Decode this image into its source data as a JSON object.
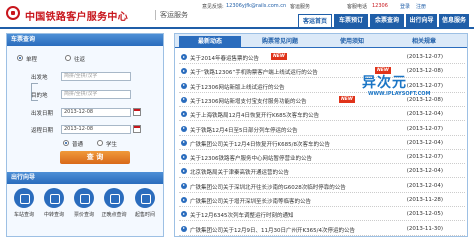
{
  "header": {
    "site_name": "中国铁路客户服务中心",
    "site_sub": "客运服务",
    "welcome": "意见反馈:",
    "email": "12306yjfk@rails.com.cn",
    "service_label": "客运服务",
    "service_hotline_label": "客服电话",
    "hotline": "12306",
    "login": "登录",
    "register": "注册"
  },
  "nav": {
    "tabs": [
      "客运首页",
      "车票预订",
      "余票查询",
      "出行向导",
      "信息服务"
    ]
  },
  "ticket_query": {
    "title": "车票查询",
    "oneway_label": "单程",
    "roundtrip_label": "往返",
    "from_label": "出发地",
    "from_placeholder": "简拼/全拼/汉字",
    "to_label": "目的地",
    "to_placeholder": "简拼/全拼/汉字",
    "depart_label": "出发日期",
    "depart_date": "2013-12-08",
    "return_label": "返程日期",
    "return_date": "2013-12-08",
    "normal_label": "普通",
    "student_label": "学生",
    "query_button": "查  询"
  },
  "travel_guide": {
    "title": "出行向导",
    "items": [
      "车站查询",
      "中转查询",
      "票价查询",
      "正晚点查询",
      "起售时间"
    ]
  },
  "news": {
    "tabs": [
      "最新动态",
      "购票常见问题",
      "使用须知",
      "相关规章"
    ],
    "items": [
      {
        "title": "关于2014年春运售票的公告",
        "new": true,
        "date": "(2013-12-07)"
      },
      {
        "title": "关于“铁路12306”手机购票客户端上线试运行的公告",
        "new": true,
        "date": "(2013-12-08)"
      },
      {
        "title": "关于12306网站新版上线试运行的公告",
        "new": false,
        "date": "(2013-12-07)"
      },
      {
        "title": "关于12306网站新增支付宝支付服务功能的公告",
        "new": true,
        "date": "(2013-12-08)"
      },
      {
        "title": "关于上海铁路局12月4日恢复开行K685次客车的公告",
        "new": false,
        "date": "(2013-12-04)"
      },
      {
        "title": "关于铁路12月4日至5日部分列车停运的公告",
        "new": false,
        "date": "(2013-12-07)"
      },
      {
        "title": "广铁集团公司关于12月4日恢复开行K685/8次客车的公告",
        "new": false,
        "date": "(2013-12-04)"
      },
      {
        "title": "关于12306铁路客户服务中心网站暂停营业的公告",
        "new": false,
        "date": "(2013-12-07)"
      },
      {
        "title": "北京铁路局关于津秦高铁开通运营的公告",
        "new": false,
        "date": "(2013-12-04)"
      },
      {
        "title": "广铁集团公司关于深圳北开往长沙南的G6028次临时停靠的公告",
        "new": false,
        "date": "(2013-12-04)"
      },
      {
        "title": "广铁集团公司关于增开深圳至长沙南等临客的公告",
        "new": false,
        "date": "(2013-11-28)"
      },
      {
        "title": "关于12月6345次列车调整运行时刻的通知",
        "new": false,
        "date": "(2013-12-05)"
      },
      {
        "title": "广铁集团公司关于12月9日、11月30日广州开K365/4次停运的公告",
        "new": false,
        "date": "(2013-11-30)"
      }
    ]
  },
  "watermark": {
    "main": "异次元",
    "sub": "WWW.IPLAYSOFT.COM"
  },
  "colors": {
    "brand_red": "#c8161d",
    "primary_blue": "#1f5ea8",
    "accent_orange": "#d8691a",
    "new_badge": "#e0331a"
  }
}
